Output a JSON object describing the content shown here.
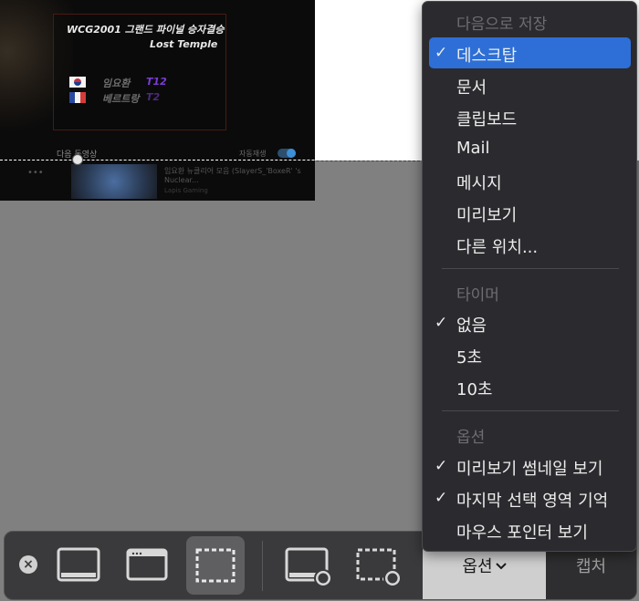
{
  "background_video": {
    "match_title": "WCG2001 그랜드 파이널 승자결승",
    "map": "Lost Temple",
    "player1": {
      "name": "임요환",
      "race": "T12"
    },
    "player2": {
      "name": "베르트랑",
      "race": "T2"
    },
    "next_label": "다음 동영상",
    "autoplay_label": "자동재생",
    "next_video_title": "임요환 뉴클리어 모음 (SlayerS_'BoxeR' 's Nuclear...",
    "next_video_channel": "Lapis Gaming",
    "more_icon": "ellipsis-icon"
  },
  "menu": {
    "sections": [
      {
        "header": "다음으로 저장",
        "items": [
          {
            "label": "데스크탑",
            "checked": true,
            "highlighted": true
          },
          {
            "label": "문서",
            "checked": false
          },
          {
            "label": "클립보드",
            "checked": false
          },
          {
            "label": "Mail",
            "checked": false
          },
          {
            "label": "메시지",
            "checked": false
          },
          {
            "label": "미리보기",
            "checked": false
          },
          {
            "label": "다른 위치...",
            "checked": false
          }
        ]
      },
      {
        "header": "타이머",
        "items": [
          {
            "label": "없음",
            "checked": true
          },
          {
            "label": "5초",
            "checked": false
          },
          {
            "label": "10초",
            "checked": false
          }
        ]
      },
      {
        "header": "옵션",
        "items": [
          {
            "label": "미리보기 썸네일 보기",
            "checked": true
          },
          {
            "label": "마지막 선택 영역 기억",
            "checked": true
          },
          {
            "label": "마우스 포인터 보기",
            "checked": false
          }
        ]
      }
    ],
    "check_glyph": "✓",
    "highlight_color": "#2d6fd6"
  },
  "toolbar": {
    "close_icon": "close-icon",
    "tools": [
      {
        "name": "capture-entire-screen-icon",
        "selected": false
      },
      {
        "name": "capture-selected-window-icon",
        "selected": false
      },
      {
        "name": "capture-selected-portion-icon",
        "selected": true
      },
      {
        "name": "record-entire-screen-icon",
        "selected": false
      },
      {
        "name": "record-selected-portion-icon",
        "selected": false
      }
    ],
    "options_label": "옵션",
    "options_chevron": "chevron-down-icon",
    "capture_label": "캡처"
  }
}
